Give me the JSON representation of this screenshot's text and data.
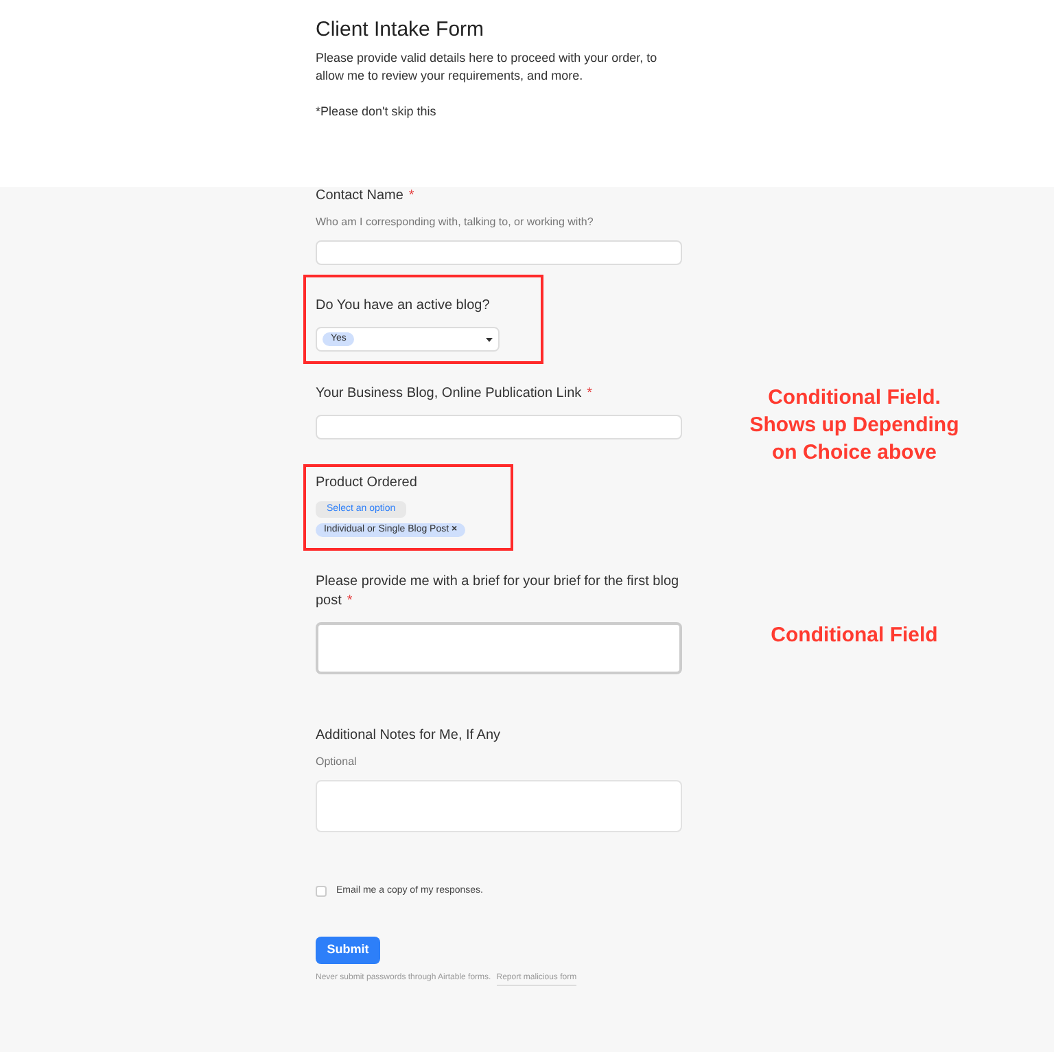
{
  "form": {
    "title": "Client Intake Form",
    "intro": "Please provide valid details here to proceed with your order, to allow me to review your requirements, and more.",
    "note": "*Please don't skip this"
  },
  "fields": [
    {
      "kind": "text",
      "label": "Contact Name",
      "required": true,
      "description": "Who am I corresponding with, talking to, or working with?",
      "highlighted": false
    },
    {
      "kind": "select",
      "label": "Do You have an active blog?",
      "required": false,
      "value": "Yes",
      "highlighted": true
    },
    {
      "kind": "text",
      "label": "Your Business Blog, Online Publication Link",
      "required": true,
      "highlighted": false,
      "annotation": "Conditional Field. Shows up Depending on Choice above"
    },
    {
      "kind": "multiselect",
      "label": "Product Ordered",
      "required": false,
      "placeholder": "Select an option",
      "chips": [
        "Individual or Single Blog Post"
      ],
      "chip_remove": "×",
      "highlighted": true
    },
    {
      "kind": "textarea",
      "label": "Please provide me with a brief for your brief for the first blog post",
      "required": true,
      "highlighted": false,
      "annotation": "Conditional Field"
    },
    {
      "kind": "textarea",
      "label": "Additional Notes for Me, If Any",
      "required": false,
      "description": "Optional",
      "highlighted": false
    }
  ],
  "email_copy": {
    "label": "Email me a copy of my responses.",
    "checked": false
  },
  "required_mark": "*",
  "submit": "Submit",
  "footer": {
    "text": "Never submit passwords through Airtable forms.",
    "link": "Report malicious form"
  }
}
